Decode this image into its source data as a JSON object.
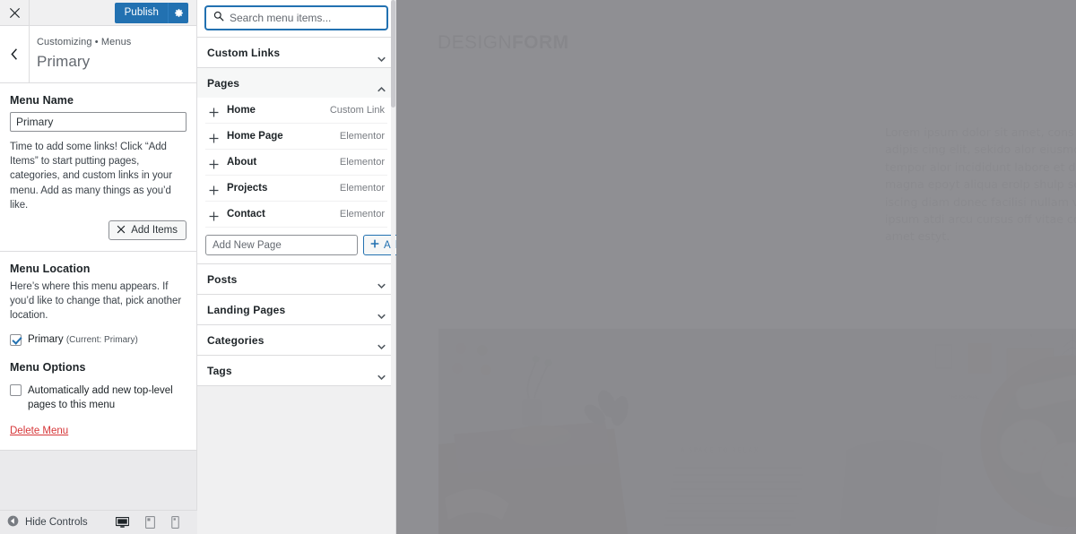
{
  "customizer": {
    "close_label": "Close",
    "publish_label": "Publish",
    "settings_icon": "gear-icon",
    "breadcrumb": "Customizing • Menus",
    "title": "Primary",
    "menu_name": {
      "label": "Menu Name",
      "value": "Primary"
    },
    "helper_text": "Time to add some links! Click “Add Items” to start putting pages, categories, and custom links in your menu. Add as many things as you’d like.",
    "add_items_label": "Add Items",
    "menu_location": {
      "title": "Menu Location",
      "description": "Here’s where this menu appears. If you’d like to change that, pick another location.",
      "checkbox_label": "Primary",
      "checkbox_sub": "(Current: Primary)",
      "checked": true
    },
    "menu_options": {
      "title": "Menu Options",
      "checkbox_label": "Automatically add new top-level pages to this menu",
      "checked": false
    },
    "delete_link": "Delete Menu",
    "bottom": {
      "hide_controls": "Hide Controls",
      "devices": [
        {
          "name": "desktop",
          "active": true
        },
        {
          "name": "tablet",
          "active": false
        },
        {
          "name": "mobile",
          "active": false
        }
      ]
    }
  },
  "items_panel": {
    "search": {
      "placeholder": "Search menu items...",
      "value": "",
      "icon": "search-icon"
    },
    "sections": [
      {
        "label": "Custom Links",
        "expanded": false
      },
      {
        "label": "Pages",
        "expanded": true
      },
      {
        "label": "Posts",
        "expanded": false
      },
      {
        "label": "Landing Pages",
        "expanded": false
      },
      {
        "label": "Categories",
        "expanded": false
      },
      {
        "label": "Tags",
        "expanded": false
      }
    ],
    "pages": [
      {
        "name": "Home",
        "type": "Custom Link"
      },
      {
        "name": "Home Page",
        "type": "Elementor"
      },
      {
        "name": "About",
        "type": "Elementor"
      },
      {
        "name": "Projects",
        "type": "Elementor"
      },
      {
        "name": "Contact",
        "type": "Elementor"
      }
    ],
    "add_new": {
      "placeholder": "Add New Page",
      "value": "",
      "button_label": "Add"
    }
  },
  "preview": {
    "logo_light": "DESIGN",
    "logo_bold": "FORM",
    "paragraph": "Lorem ipsum dolor sit amet, cons ectet adipis cing elit, sekido alor eiusmod opli tempor alor incididunt labore et dolore magna epoyt aliqua erolp shulp sed ad opti iscing diam donec facilisi nullam vehicula ipsum atdi arcu cursus off vitae congue amet estyt.",
    "hero_image_alt": "open magazine on bed with cookies on wooden plate"
  },
  "colors": {
    "wp_blue": "#2271b1",
    "delete_red": "#d63638",
    "panel_grey": "#f0f0f1",
    "preview_veil": "#8b8b8f"
  }
}
